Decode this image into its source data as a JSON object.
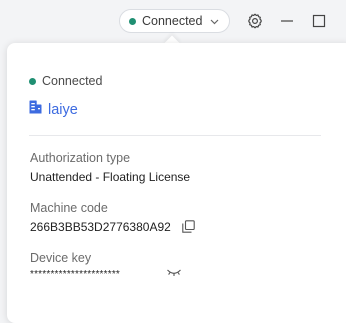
{
  "colors": {
    "status_green": "#1f8f72",
    "accent_blue": "#3d6be0",
    "icon_gray": "#555555"
  },
  "header": {
    "status_chip": {
      "label": "Connected",
      "dot_icon": "status-dot",
      "dropdown_icon": "chevron-down-icon"
    },
    "icons": [
      "gear-icon",
      "minimize-icon",
      "maximize-icon"
    ]
  },
  "popover": {
    "status": "Connected",
    "user": {
      "icon": "building-icon",
      "name": "laiye"
    },
    "authorization": {
      "label": "Authorization type",
      "value": "Unattended - Floating License"
    },
    "machine_code": {
      "label": "Machine code",
      "value": "266B3BB53D2776380A92",
      "copy_icon": "copy-icon"
    },
    "device_key": {
      "label": "Device key",
      "value": "**********************",
      "toggle_icon": "eye-closed-icon"
    }
  }
}
